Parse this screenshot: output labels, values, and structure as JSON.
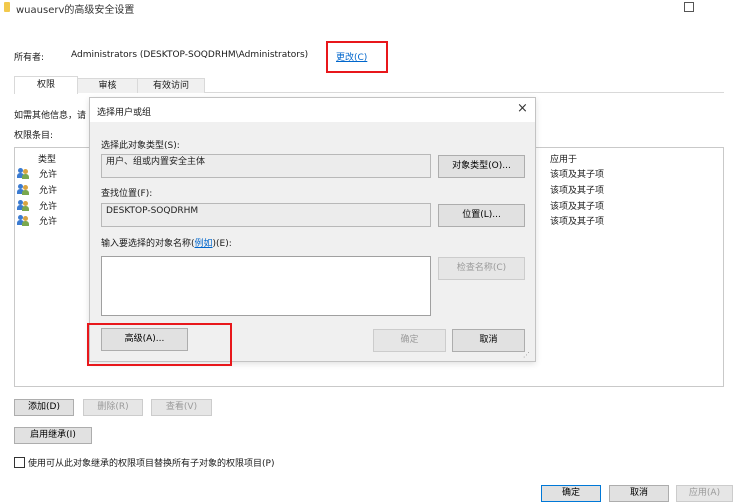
{
  "window": {
    "title": "wuauserv的高级安全设置",
    "owner_label": "所有者:",
    "owner_value": "Administrators (DESKTOP-SOQDRHM\\Administrators)",
    "change_link": "更改(C)"
  },
  "tabs": [
    "权限",
    "审核",
    "有效访问"
  ],
  "info_text": "如需其他信息，请",
  "perm_entries_label": "权限条目:",
  "table": {
    "col_type": "类型",
    "col_applies": "应用于",
    "rows": [
      {
        "type": "允许",
        "applies": "该项及其子项"
      },
      {
        "type": "允许",
        "applies": "该项及其子项"
      },
      {
        "type": "允许",
        "applies": "该项及其子项"
      },
      {
        "type": "允许",
        "applies": "该项及其子项"
      }
    ]
  },
  "bottom": {
    "add": "添加(D)",
    "remove": "删除(R)",
    "view": "查看(V)",
    "enable_inherit": "启用继承(I)",
    "replace_checkbox": "使用可从此对象继承的权限项目替换所有子对象的权限项目(P)",
    "ok": "确定",
    "cancel": "取消",
    "apply": "应用(A)"
  },
  "dialog": {
    "title": "选择用户或组",
    "select_type_label": "选择此对象类型(S):",
    "select_type_value": "用户、组或内置安全主体",
    "object_types_btn": "对象类型(O)...",
    "location_label": "查找位置(F):",
    "location_value": "DESKTOP-SOQDRHM",
    "locations_btn": "位置(L)...",
    "enter_names_label": "输入要选择的对象名称(",
    "examples_link": "例如",
    "enter_names_suffix": ")(E):",
    "check_names_btn": "检查名称(C)",
    "advanced_btn": "高级(A)...",
    "ok_btn": "确定",
    "cancel_btn": "取消"
  },
  "colors": {
    "highlight": "#e8171b",
    "link": "#0066cc",
    "dialog_bg": "#f0f0f0"
  }
}
